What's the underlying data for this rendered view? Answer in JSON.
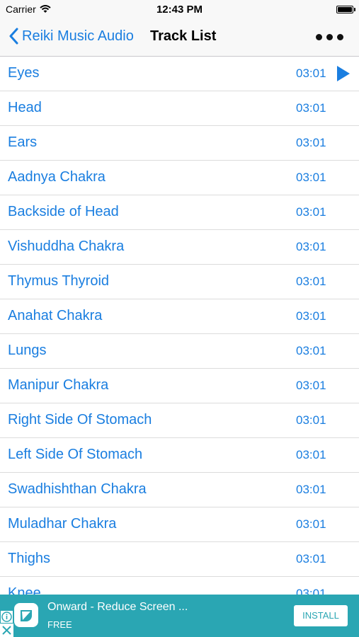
{
  "status_bar": {
    "carrier": "Carrier",
    "time": "12:43 PM"
  },
  "nav": {
    "back_label": "Reiki Music Audio",
    "title": "Track List",
    "more_icon": "more-dots-icon"
  },
  "tracks": [
    {
      "name": "Eyes",
      "duration": "03:01",
      "playing": true
    },
    {
      "name": "Head",
      "duration": "03:01"
    },
    {
      "name": "Ears",
      "duration": "03:01"
    },
    {
      "name": "Aadnya Chakra",
      "duration": "03:01"
    },
    {
      "name": "Backside of Head",
      "duration": "03:01"
    },
    {
      "name": "Vishuddha Chakra",
      "duration": "03:01"
    },
    {
      "name": "Thymus Thyroid",
      "duration": "03:01"
    },
    {
      "name": "Anahat Chakra",
      "duration": "03:01"
    },
    {
      "name": "Lungs",
      "duration": "03:01"
    },
    {
      "name": "Manipur Chakra",
      "duration": "03:01"
    },
    {
      "name": "Right Side Of Stomach",
      "duration": "03:01"
    },
    {
      "name": "Left Side Of Stomach",
      "duration": "03:01"
    },
    {
      "name": "Swadhishthan Chakra",
      "duration": "03:01"
    },
    {
      "name": "Muladhar Chakra",
      "duration": "03:01"
    },
    {
      "name": "Thighs",
      "duration": "03:01"
    },
    {
      "name": "Knee",
      "duration": "03:01"
    }
  ],
  "ad": {
    "title": "Onward - Reduce Screen ...",
    "subtitle": "FREE",
    "install_label": "INSTALL"
  },
  "colors": {
    "accent": "#1a7ee0",
    "ad_background": "#2aa6b3"
  }
}
